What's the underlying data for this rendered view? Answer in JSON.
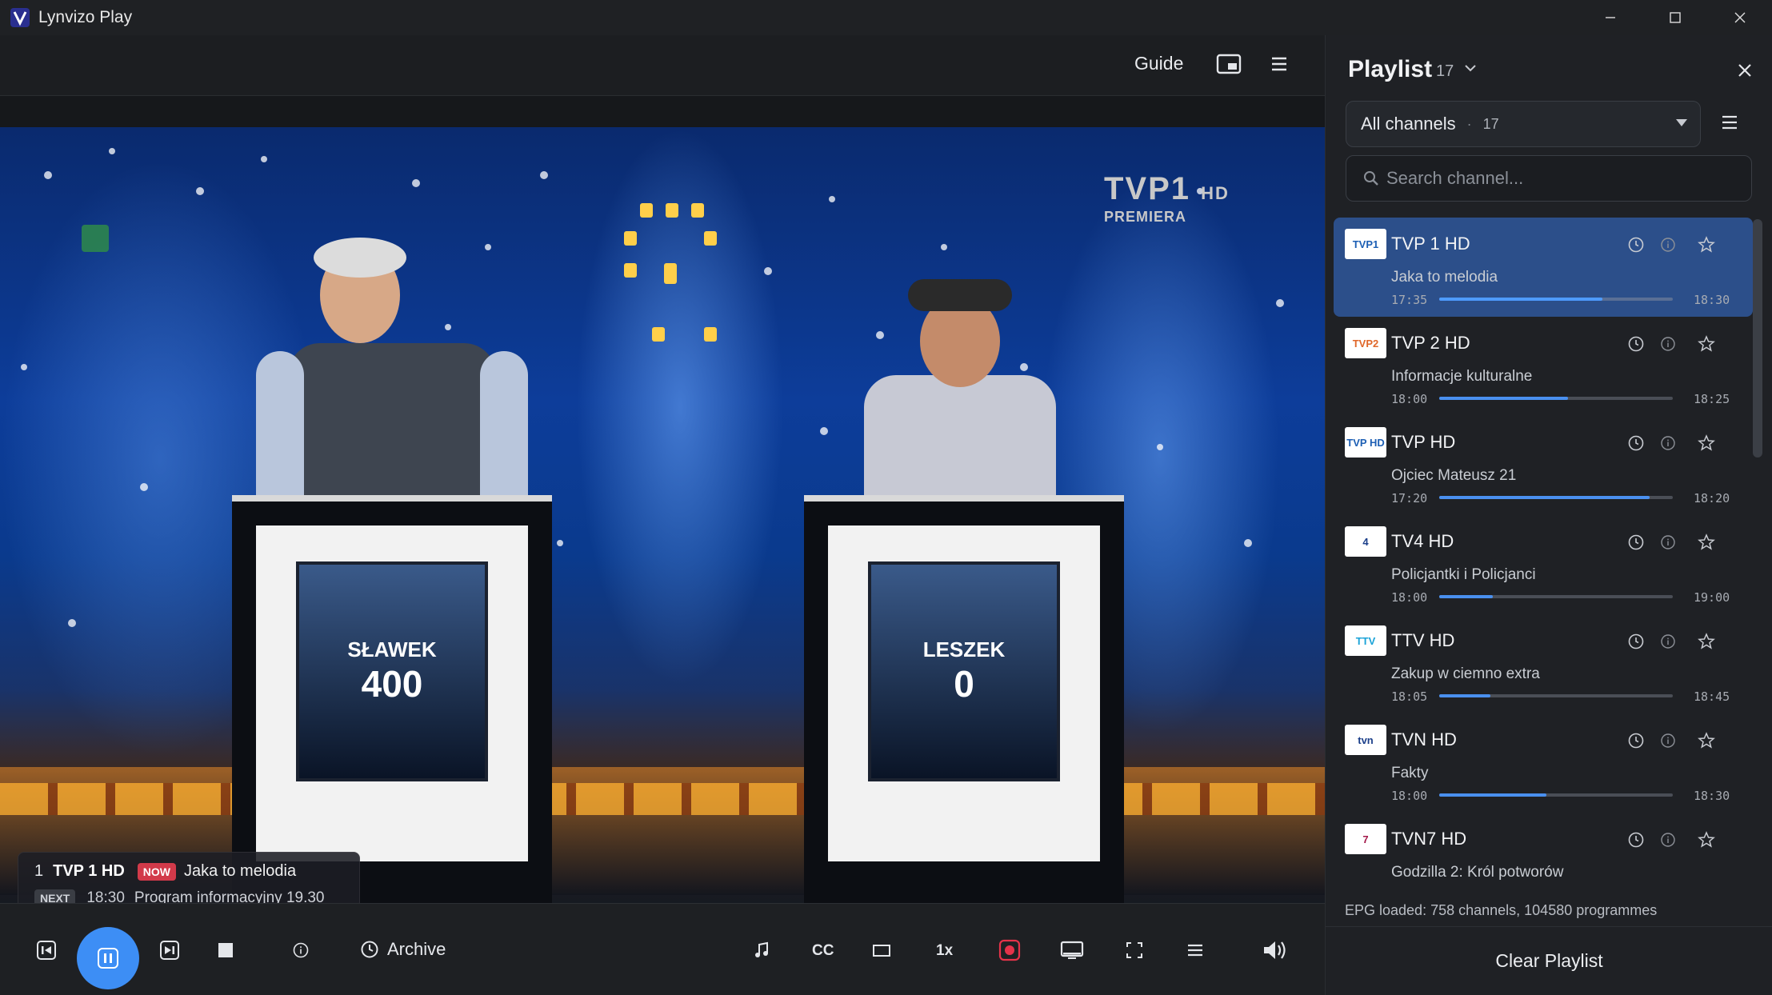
{
  "window": {
    "title": "Lynvizo Play",
    "controls": [
      "minimize",
      "maximize",
      "close"
    ]
  },
  "player_top": {
    "guide_label": "Guide",
    "icons": [
      "picture-in-picture-icon",
      "menu-icon"
    ]
  },
  "video": {
    "broadcaster_logo": "TVP1",
    "broadcaster_badge": "HD",
    "broadcaster_sub": "PREMIERA",
    "podiums": [
      {
        "name": "SŁAWEK",
        "score": "400"
      },
      {
        "name": "LESZEK",
        "score": "0"
      }
    ]
  },
  "osd": {
    "number": "1",
    "channel": "TVP 1 HD",
    "now_badge": "NOW",
    "now_program": "Jaka to melodia",
    "next_badge": "NEXT",
    "next_time": "18:30",
    "next_program": "Program informacyjny 19.30"
  },
  "controls": {
    "archive_label": "Archive",
    "cc_label": "CC",
    "speed_label": "1x",
    "accent": "#3d8ef5",
    "record_color": "#e5334a"
  },
  "playlist": {
    "title": "Playlist",
    "count": "17",
    "filter": {
      "label": "All channels",
      "separator": "·",
      "count": "17"
    },
    "search_placeholder": "Search channel...",
    "channels": [
      {
        "name": "TVP 1 HD",
        "program": "Jaka to melodia",
        "start": "17:35",
        "end": "18:30",
        "progress": 0.7,
        "logo_text": "TVP1",
        "logo_bg": "#ffffff",
        "logo_fg": "#1d5fb4",
        "active": true
      },
      {
        "name": "TVP 2 HD",
        "program": "Informacje kulturalne",
        "start": "18:00",
        "end": "18:25",
        "progress": 0.55,
        "logo_text": "TVP2",
        "logo_bg": "#ffffff",
        "logo_fg": "#e0672a",
        "active": false
      },
      {
        "name": "TVP HD",
        "program": "Ojciec Mateusz 21",
        "start": "17:20",
        "end": "18:20",
        "progress": 0.9,
        "logo_text": "TVP HD",
        "logo_bg": "#ffffff",
        "logo_fg": "#1d5fb4",
        "active": false
      },
      {
        "name": "TV4 HD",
        "program": "Policjantki i Policjanci",
        "start": "18:00",
        "end": "19:00",
        "progress": 0.23,
        "logo_text": "4",
        "logo_bg": "#ffffff",
        "logo_fg": "#1b3f8a",
        "active": false
      },
      {
        "name": "TTV HD",
        "program": "Zakup w ciemno extra",
        "start": "18:05",
        "end": "18:45",
        "progress": 0.22,
        "logo_text": "TTV",
        "logo_bg": "#ffffff",
        "logo_fg": "#1aa3d8",
        "active": false
      },
      {
        "name": "TVN HD",
        "program": "Fakty",
        "start": "18:00",
        "end": "18:30",
        "progress": 0.46,
        "logo_text": "tvn",
        "logo_bg": "#ffffff",
        "logo_fg": "#1b3f8a",
        "active": false
      },
      {
        "name": "TVN7 HD",
        "program": "Godzilla 2: Król potworów",
        "start": "",
        "end": "",
        "progress": 0,
        "logo_text": "7",
        "logo_bg": "#ffffff",
        "logo_fg": "#a3194a",
        "active": false
      }
    ],
    "epg_status": "EPG loaded: 758 channels, 104580 programmes",
    "clear_label": "Clear Playlist"
  }
}
